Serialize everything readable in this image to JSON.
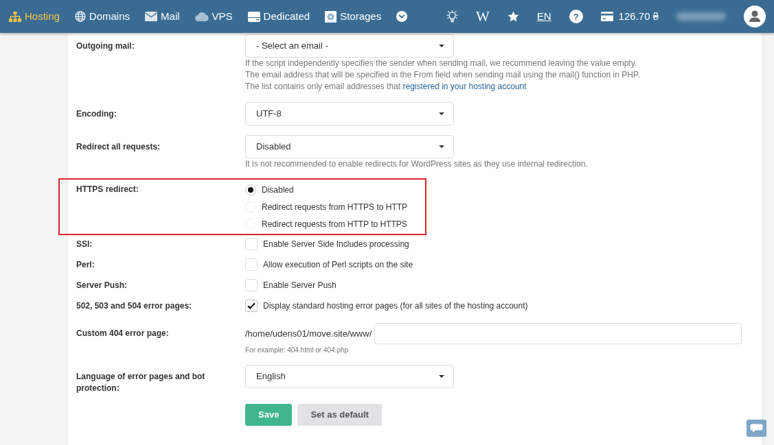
{
  "navbar": {
    "items": [
      {
        "label": "Hosting",
        "selected": true
      },
      {
        "label": "Domains",
        "selected": false
      },
      {
        "label": "Mail",
        "selected": false
      },
      {
        "label": "VPS",
        "selected": false
      },
      {
        "label": "Dedicated",
        "selected": false
      },
      {
        "label": "Storages",
        "selected": false
      }
    ],
    "wiki": "W",
    "language": "EN",
    "help": "?",
    "balance": "126.70 ₴"
  },
  "settings": [
    {
      "kind": "select",
      "label": "Outgoing mail:",
      "value": "- Select an email -",
      "highlighted": false,
      "help": [
        {
          "text": "If the script independently specifies the sender when sending mail, we recommend leaving the value empty."
        },
        {
          "text": "The email address that will be specified in the From field when sending mail using the mail() function in PHP."
        },
        {
          "text": "The list contains only email addresses that",
          "link": "registered in your hosting account"
        }
      ]
    },
    {
      "kind": "select",
      "label": "Encoding:",
      "value": "UTF-8",
      "highlighted": false
    },
    {
      "kind": "select",
      "label": "Redirect all requests:",
      "value": "Disabled",
      "highlighted": false,
      "help": [
        {
          "text": "It is not recommended to enable redirects for WordPress sites as they use internal redirection."
        }
      ]
    },
    {
      "kind": "radio",
      "label": "HTTPS redirect:",
      "highlighted": true,
      "options": [
        {
          "label": "Disabled",
          "selected": true
        },
        {
          "label": "Redirect requests from HTTPS to HTTP",
          "selected": false
        },
        {
          "label": "Redirect requests from HTTP to HTTPS",
          "selected": false
        }
      ]
    },
    {
      "kind": "checkbox",
      "label": "SSI:",
      "option": "Enable Server Side Includes processing",
      "checked": false,
      "highlighted": false
    },
    {
      "kind": "checkbox",
      "label": "Perl:",
      "option": "Allow execution of Perl scripts on the site",
      "checked": false,
      "highlighted": false
    },
    {
      "kind": "checkbox",
      "label": "Server Push:",
      "option": "Enable Server Push",
      "checked": false,
      "highlighted": false
    },
    {
      "kind": "checkbox",
      "label": "502, 503 and 504 error pages:",
      "option": "Display standard hosting error pages (for all sites of the hosting account)",
      "checked": true,
      "highlighted": false
    },
    {
      "kind": "path",
      "label": "Custom 404 error page:",
      "prefix": "/home/udens01/move.site/www/",
      "hint": "For example: 404.html or 404.php",
      "highlighted": false
    },
    {
      "kind": "select",
      "label": "Language of error pages and bot protection:",
      "value": "English",
      "highlighted": false
    }
  ],
  "buttons": [
    {
      "label": "Save",
      "kind": "primary"
    },
    {
      "label": "Set as default",
      "kind": "secondary"
    }
  ]
}
